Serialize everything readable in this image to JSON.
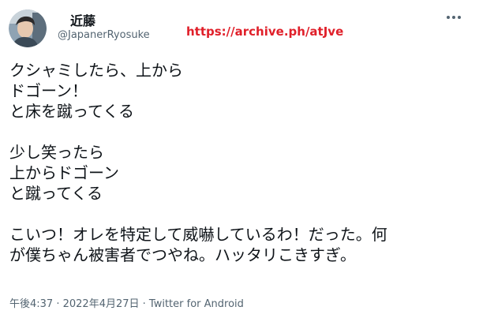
{
  "tweet": {
    "display_name": "近藤",
    "handle": "@JapanerRyosuke",
    "archive_link": "https://archive.ph/atJve",
    "more_icon": "more-horizontal-icon",
    "paragraphs": [
      [
        "クシャミしたら、上から",
        "ドゴーン！",
        "と床を蹴ってくる"
      ],
      [
        "少し笑ったら",
        "上からドゴーン",
        "と蹴ってくる"
      ],
      [
        "こいつ！オレを特定して威嚇しているわ！だった。何",
        "が僕ちゃん被害者でつやね。ハッタリこきすぎ。"
      ]
    ],
    "time": "午後4:37",
    "separator_1": " · ",
    "date": "2022年4月27日",
    "separator_2": " · ",
    "source": "Twitter for Android"
  },
  "colors": {
    "text": "#0f1419",
    "secondary": "#536471",
    "archive_link": "#e0202a"
  }
}
